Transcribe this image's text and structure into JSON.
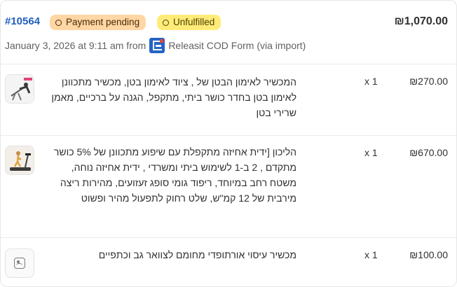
{
  "order": {
    "id": "#10564",
    "payment_status": "Payment pending",
    "fulfillment_status": "Unfulfilled",
    "total": "₪1,070.00",
    "date": "January 3, 2026 at 9:11 am from",
    "source": "Releasit COD Form (via import)"
  },
  "colors": {
    "link": "#1f5fbf",
    "payment_badge_bg": "#ffd6a4",
    "fulfillment_badge_bg": "#ffeb78",
    "app_icon": "#2463c7"
  },
  "line_items": [
    {
      "title": "המכשיר לאימון הבטן של , ציוד לאימון בטן, מכשיר מתכוונן לאימון בטן בחדר כושר ביתי, מתקפל, הגנה על ברכיים, מאמן שרירי בטן",
      "quantity": "x 1",
      "price": "₪270.00",
      "image_icon": "ab-trainer-product-image"
    },
    {
      "title": "הליכון [ידית אחיזה מתקפלת עם שיפוע מתכוונן של 5% כושר מתקדם , 2 ב-1 לשימוש ביתי ומשרדי , ידית אחיזה נוחה, משטח רחב במיוחד, ריפוד גומי סופג זעזועים, מהירות ריצה מירבית של 12 קמ\"ש, שלט רחוק לתפעול מהיר ופשוט",
      "quantity": "x 1",
      "price": "₪670.00",
      "image_icon": "treadmill-product-image"
    },
    {
      "title": "מכשיר עיסוי אורתופדי מחומם לצוואר גב וכתפיים",
      "quantity": "x 1",
      "price": "₪100.00",
      "image_icon": "image-placeholder-icon"
    }
  ]
}
